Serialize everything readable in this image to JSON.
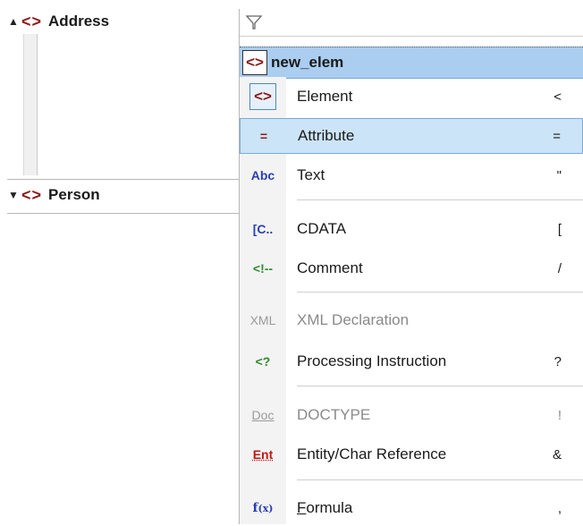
{
  "tree": {
    "rows": [
      {
        "expander": "▲",
        "icon": "<>",
        "label": "Address"
      },
      {
        "expander": "▼",
        "icon": "<>",
        "label": "Person"
      }
    ]
  },
  "grid": {
    "header": {
      "icon": "<>",
      "label": "new_elem"
    }
  },
  "menu": {
    "items": [
      {
        "icon": "<>",
        "label": "Element",
        "key": "<"
      },
      {
        "icon": "=",
        "label": "Attribute",
        "key": "="
      },
      {
        "icon": "Abc",
        "label": "Text",
        "key": "\""
      },
      {
        "icon": "[C..",
        "label": "CDATA",
        "key": "["
      },
      {
        "icon": "<!--",
        "label": "Comment",
        "key": "/"
      },
      {
        "icon": "XML",
        "label": "XML Declaration",
        "key": ""
      },
      {
        "icon": "<?",
        "label": "Processing Instruction",
        "key": "?"
      },
      {
        "icon": "Doc",
        "label": "DOCTYPE",
        "key": "!"
      },
      {
        "icon": "Ent",
        "label": "Entity/Char Reference",
        "key": "&"
      },
      {
        "icon_main": "f",
        "icon_sub": "(x)",
        "label_first": "F",
        "label_rest": "ormula",
        "key": ","
      }
    ]
  }
}
